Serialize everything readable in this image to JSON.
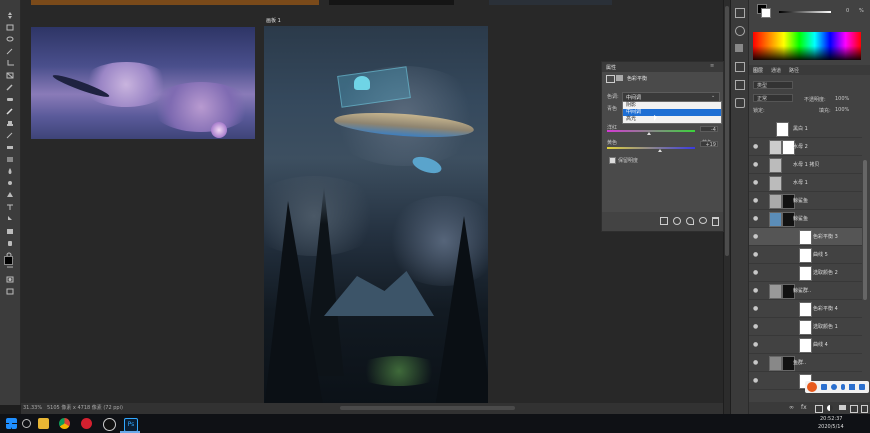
{
  "document": {
    "tab_title": "画板 1",
    "status_zoom": "31.33%",
    "status_info": "5105 像素 x 4718 像素 (72 ppi)"
  },
  "properties_panel": {
    "tab_label": "属性",
    "adjustment_title": "色彩平衡",
    "tone_label": "色调:",
    "tone_value": "中间调",
    "tone_options": [
      "阴影",
      "中间调",
      "高光"
    ],
    "selected_option_index": 1,
    "slider_cyan_label": "青色",
    "slider_red_label": "红色",
    "slider_red_value": "0",
    "slider_magenta_label": "洋红",
    "slider_green_value": "-4",
    "slider_yellow_label": "黄色",
    "slider_blue_label": "蓝色",
    "slider_blue_value": "+19",
    "preserve_luminosity_label": "保留明度",
    "preserve_luminosity_checked": true
  },
  "color_panel": {
    "slider_value": "0",
    "slider_percent": "%"
  },
  "layers_panel": {
    "tabs": [
      "图层",
      "通道",
      "路径"
    ],
    "filter_kind": "类型",
    "blend_mode": "正常",
    "opacity_label": "不透明度:",
    "opacity_value": "100%",
    "lock_label": "锁定:",
    "fill_label": "填充:",
    "fill_value": "100%",
    "layers": [
      {
        "name": "黑白 1",
        "type": "adjustment"
      },
      {
        "name": "水母 2",
        "type": "pixel"
      },
      {
        "name": "水母 1 拷贝",
        "type": "pixel"
      },
      {
        "name": "水母 1",
        "type": "pixel"
      },
      {
        "name": "鲸鲨鱼",
        "type": "pixel"
      },
      {
        "name": "鲸鲨鱼",
        "type": "pixel"
      },
      {
        "name": "色彩平衡 3",
        "type": "adjustment",
        "selected": true
      },
      {
        "name": "曲线 5",
        "type": "adjustment"
      },
      {
        "name": "选取颜色 2",
        "type": "adjustment"
      },
      {
        "name": "鲸鲨群..",
        "type": "pixel"
      },
      {
        "name": "色彩平衡 4",
        "type": "adjustment"
      },
      {
        "name": "选取颜色 1",
        "type": "adjustment"
      },
      {
        "name": "曲线 4",
        "type": "adjustment"
      },
      {
        "name": "鱼群..",
        "type": "pixel"
      },
      {
        "name": "",
        "type": "adjustment"
      }
    ]
  },
  "taskbar": {
    "time": "20:52:37",
    "date": "2020/5/14",
    "app_icons": [
      "windows-icon",
      "search-icon",
      "file-explorer-icon",
      "chrome-icon",
      "netease-music-icon",
      "app-icon",
      "photoshop-icon"
    ],
    "active_app_label": "Ps"
  },
  "colors": {
    "accent": "#1e6fd4",
    "panel_bg": "#424242",
    "workspace_bg": "#282828"
  }
}
